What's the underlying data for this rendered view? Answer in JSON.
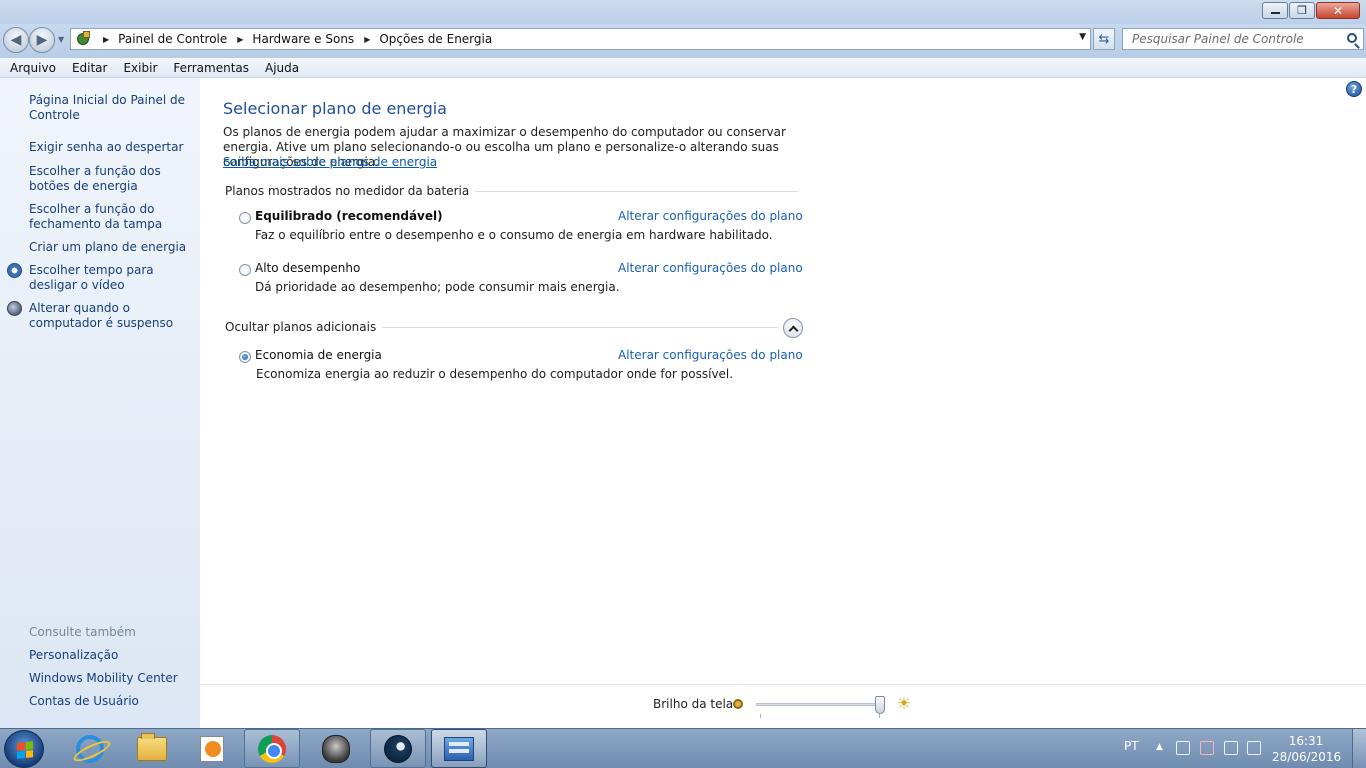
{
  "window": {
    "minimize_label": "",
    "restore_glyph": "❐",
    "close_glyph": "✕"
  },
  "address": {
    "breadcrumbs": [
      "Painel de Controle",
      "Hardware e Sons",
      "Opções de Energia"
    ],
    "separator": "▶",
    "search_placeholder": "Pesquisar Painel de Controle"
  },
  "menu": [
    "Arquivo",
    "Editar",
    "Exibir",
    "Ferramentas",
    "Ajuda"
  ],
  "sidebar": {
    "items": [
      "Página Inicial do Painel de Controle",
      "Exigir senha ao despertar",
      "Escolher a função dos botões de energia",
      "Escolher a função do fechamento da tampa",
      "Criar um plano de energia",
      "Escolher tempo para desligar o vídeo",
      "Alterar quando o computador é suspenso"
    ],
    "see_also_header": "Consulte também",
    "see_also": [
      "Personalização",
      "Windows Mobility Center",
      "Contas de Usuário"
    ]
  },
  "main": {
    "title": "Selecionar plano de energia",
    "intro": "Os planos de energia podem ajudar a maximizar o desempenho do computador ou conservar energia. Ative um plano selecionando-o ou escolha um plano e personalize-o alterando suas configurações de energia.",
    "learn_more": "Saiba mais sobre planos de energia",
    "group1_header": "Planos mostrados no medidor da bateria",
    "group2_header": "Ocultar planos adicionais",
    "change_link": "Alterar configurações do plano",
    "plans": [
      {
        "name": "Equilibrado (recomendável)",
        "desc": "Faz o equilíbrio entre o desempenho e o consumo de energia em hardware habilitado.",
        "selected": false
      },
      {
        "name": "Alto desempenho",
        "desc": "Dá prioridade ao desempenho; pode consumir mais energia.",
        "selected": false
      },
      {
        "name": "Economia de energia",
        "desc": "Economiza energia ao reduzir o desempenho do computador onde for possível.",
        "selected": true
      }
    ]
  },
  "brightness": {
    "label": "Brilho da tela:",
    "level": 0.97
  },
  "taskbar": {
    "language": "PT",
    "time": "16:31",
    "date": "28/06/2016"
  }
}
